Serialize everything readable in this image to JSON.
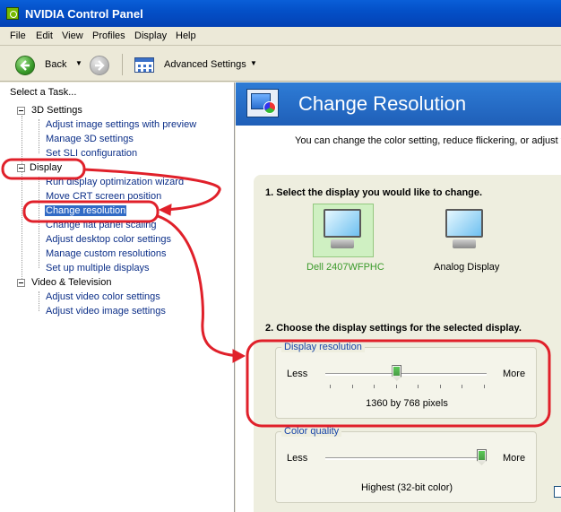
{
  "window": {
    "title": "NVIDIA Control Panel"
  },
  "menu": [
    "File",
    "Edit",
    "View",
    "Profiles",
    "Display",
    "Help"
  ],
  "toolbar": {
    "back_label": "Back",
    "advanced_label": "Advanced Settings"
  },
  "left": {
    "pane_label": "Select a Task...",
    "categories": [
      {
        "label": "3D Settings",
        "tasks": [
          "Adjust image settings with preview",
          "Manage 3D settings",
          "Set SLI configuration"
        ]
      },
      {
        "label": "Display",
        "tasks": [
          "Run display optimization wizard",
          "Move CRT screen position",
          "Change resolution",
          "Change flat panel scaling",
          "Adjust desktop color settings",
          "Manage custom resolutions",
          "Set up multiple displays"
        ]
      },
      {
        "label": "Video & Television",
        "tasks": [
          "Adjust video color settings",
          "Adjust video image settings"
        ]
      }
    ],
    "selected_task": "Change resolution"
  },
  "right": {
    "title": "Change Resolution",
    "description": "You can change the color setting, reduce flickering, or adjust th",
    "step1": "1. Select the display you would like to change.",
    "displays": [
      {
        "name": "Dell 2407WFPHC",
        "selected": true,
        "label_color": "#3a9a2a"
      },
      {
        "name": "Analog Display",
        "selected": false
      }
    ],
    "step2": "2. Choose the display settings for the selected display.",
    "resolution": {
      "legend": "Display resolution",
      "less": "Less",
      "more": "More",
      "value": "1360 by 768 pixels",
      "position_fraction": 0.44
    },
    "color_quality": {
      "legend": "Color quality",
      "less": "Less",
      "more": "More",
      "value": "Highest (32-bit color)",
      "position_fraction": 1.0
    }
  },
  "annotation_color": "#e0202a"
}
